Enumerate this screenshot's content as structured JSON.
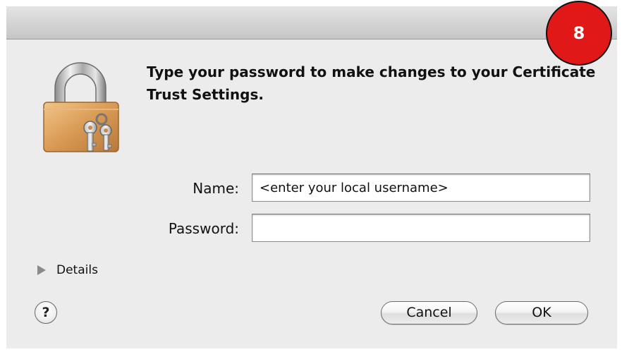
{
  "dialog": {
    "message": "Type your password to make changes to your Certificate Trust Settings.",
    "icon": "lock-icon"
  },
  "step_badge": "8",
  "form": {
    "name_label": "Name:",
    "name_value": "<enter your local username>",
    "password_label": "Password:",
    "password_value": ""
  },
  "details": {
    "label": "Details",
    "icon": "disclosure-triangle-icon"
  },
  "buttons": {
    "help": "?",
    "cancel": "Cancel",
    "ok": "OK"
  },
  "colors": {
    "badge": "#e01818",
    "dialog_bg": "#ececec"
  }
}
